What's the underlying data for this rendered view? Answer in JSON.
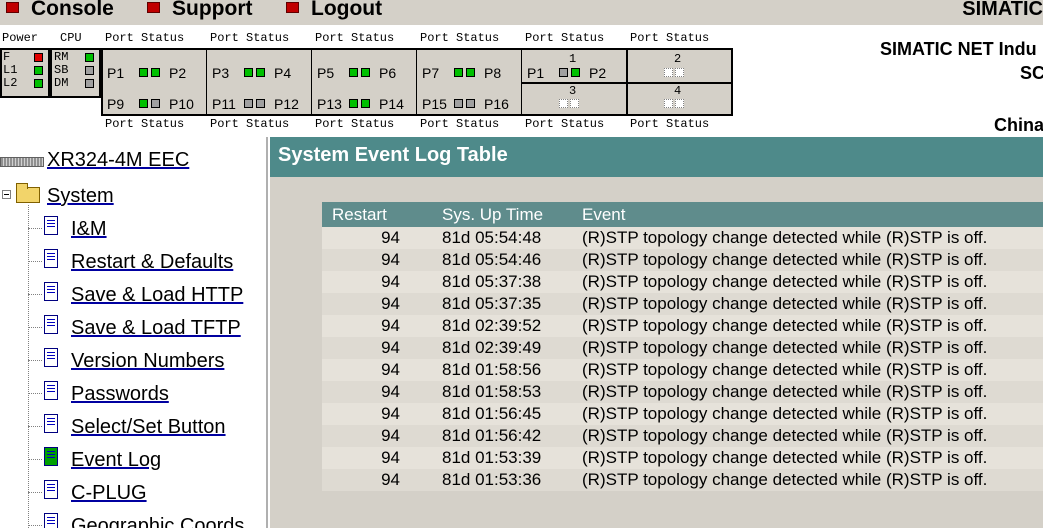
{
  "nav": {
    "console": "Console",
    "support": "Support",
    "logout": "Logout",
    "brand": "SIMATIC"
  },
  "status_panel": {
    "power_label": "Power",
    "cpu_label": "CPU",
    "port_status_label": "Port Status",
    "power_rows": [
      "F",
      "L1",
      "L2"
    ],
    "cpu_rows": [
      "RM",
      "SB",
      "DM"
    ],
    "ports_top": [
      [
        "P1",
        "P2"
      ],
      [
        "P3",
        "P4"
      ],
      [
        "P5",
        "P6"
      ],
      [
        "P7",
        "P8"
      ]
    ],
    "ports_bottom": [
      [
        "P9",
        "P10"
      ],
      [
        "P11",
        "P12"
      ],
      [
        "P13",
        "P14"
      ],
      [
        "P15",
        "P16"
      ]
    ],
    "module1": {
      "num": "1",
      "left": "P1",
      "right": "P2"
    },
    "module2": "2",
    "module3": "3",
    "module4": "4",
    "brand_name": "SIMATIC NET Indu",
    "brand_sub": "SC",
    "brand_china": "China"
  },
  "tree": {
    "device": "XR324-4M EEC",
    "system": "System",
    "items": [
      "I&M",
      "Restart & Defaults",
      "Save & Load HTTP",
      "Save & Load TFTP",
      "Version Numbers",
      "Passwords",
      "Select/Set Button",
      "Event Log",
      "C-PLUG",
      "Geographic Coords"
    ],
    "active": "Event Log"
  },
  "content": {
    "title": "System Event Log Table",
    "columns": [
      "Restart",
      "Sys. Up Time",
      "Event"
    ],
    "rows": [
      [
        "94",
        "81d 05:54:48",
        "(R)STP topology change detected while (R)STP is off."
      ],
      [
        "94",
        "81d 05:54:46",
        "(R)STP topology change detected while (R)STP is off."
      ],
      [
        "94",
        "81d 05:37:38",
        "(R)STP topology change detected while (R)STP is off."
      ],
      [
        "94",
        "81d 05:37:35",
        "(R)STP topology change detected while (R)STP is off."
      ],
      [
        "94",
        "81d 02:39:52",
        "(R)STP topology change detected while (R)STP is off."
      ],
      [
        "94",
        "81d 02:39:49",
        "(R)STP topology change detected while (R)STP is off."
      ],
      [
        "94",
        "81d 01:58:56",
        "(R)STP topology change detected while (R)STP is off."
      ],
      [
        "94",
        "81d 01:58:53",
        "(R)STP topology change detected while (R)STP is off."
      ],
      [
        "94",
        "81d 01:56:45",
        "(R)STP topology change detected while (R)STP is off."
      ],
      [
        "94",
        "81d 01:56:42",
        "(R)STP topology change detected while (R)STP is off."
      ],
      [
        "94",
        "81d 01:53:39",
        "(R)STP topology change detected while (R)STP is off."
      ],
      [
        "94",
        "81d 01:53:36",
        "(R)STP topology change detected while (R)STP is off."
      ]
    ]
  },
  "colors": {
    "title_bar": "#4e8a8a",
    "table_header": "#5f8c8c",
    "led_on": "#00c000",
    "led_fault": "#e00000",
    "nav_icon": "#c00000"
  }
}
